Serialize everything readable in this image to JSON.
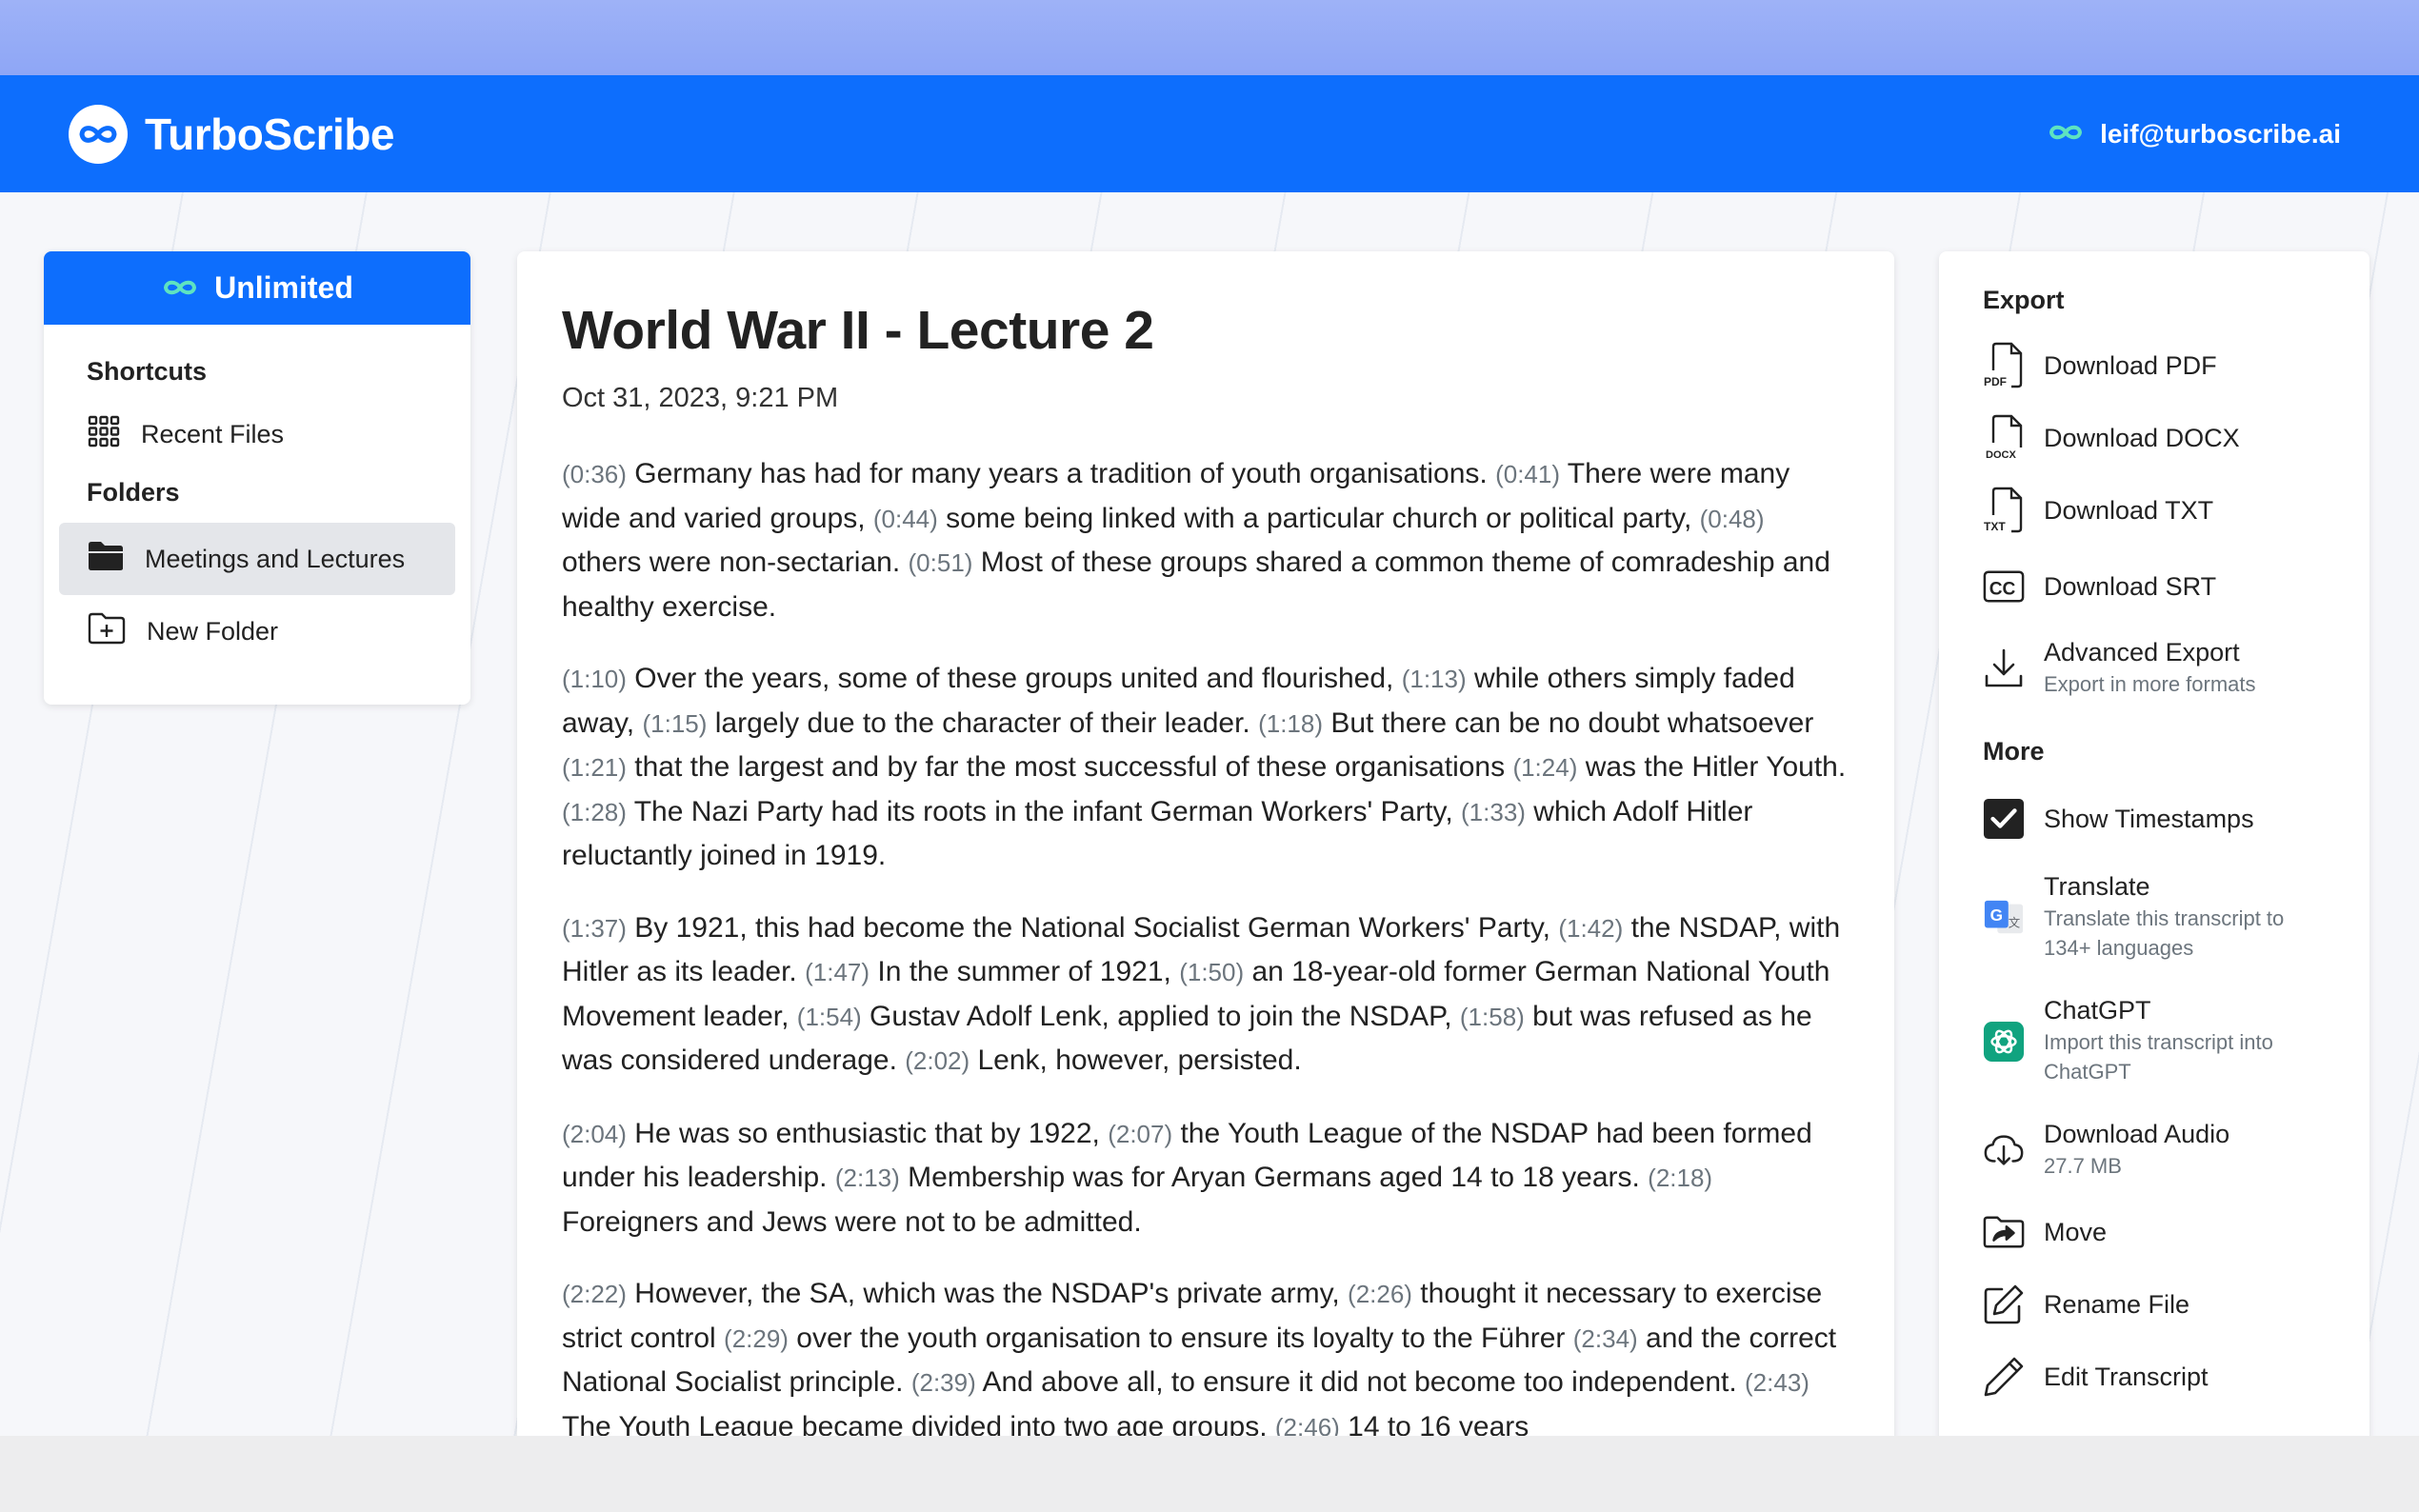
{
  "header": {
    "brand_name": "TurboScribe",
    "user_email": "leif@turboscribe.ai"
  },
  "sidebar": {
    "plan_label": "Unlimited",
    "shortcuts_heading": "Shortcuts",
    "recent_files_label": "Recent Files",
    "folders_heading": "Folders",
    "folders": [
      {
        "label": "Meetings and Lectures",
        "active": true
      },
      {
        "label": "New Folder",
        "active": false
      }
    ]
  },
  "document": {
    "title": "World War II - Lecture 2",
    "date": "Oct 31, 2023, 9:21 PM",
    "paragraphs": [
      [
        {
          "ts": "(0:36)",
          "text": " Germany has had for many years a tradition of youth organisations. "
        },
        {
          "ts": "(0:41)",
          "text": " There were many wide and varied groups, "
        },
        {
          "ts": "(0:44)",
          "text": " some being linked with a particular church or political party, "
        },
        {
          "ts": "(0:48)",
          "text": " others were non-sectarian. "
        },
        {
          "ts": "(0:51)",
          "text": " Most of these groups shared a common theme of comradeship and healthy exercise."
        }
      ],
      [
        {
          "ts": "(1:10)",
          "text": " Over the years, some of these groups united and flourished, "
        },
        {
          "ts": "(1:13)",
          "text": " while others simply faded away, "
        },
        {
          "ts": "(1:15)",
          "text": " largely due to the character of their leader. "
        },
        {
          "ts": "(1:18)",
          "text": " But there can be no doubt whatsoever "
        },
        {
          "ts": "(1:21)",
          "text": " that the largest and by far the most successful of these organisations "
        },
        {
          "ts": "(1:24)",
          "text": " was the Hitler Youth. "
        },
        {
          "ts": "(1:28)",
          "text": " The Nazi Party had its roots in the infant German Workers' Party, "
        },
        {
          "ts": "(1:33)",
          "text": " which Adolf Hitler reluctantly joined in 1919."
        }
      ],
      [
        {
          "ts": "(1:37)",
          "text": " By 1921, this had become the National Socialist German Workers' Party, "
        },
        {
          "ts": "(1:42)",
          "text": " the NSDAP, with Hitler as its leader. "
        },
        {
          "ts": "(1:47)",
          "text": " In the summer of 1921, "
        },
        {
          "ts": "(1:50)",
          "text": " an 18-year-old former German National Youth Movement leader, "
        },
        {
          "ts": "(1:54)",
          "text": " Gustav Adolf Lenk, applied to join the NSDAP, "
        },
        {
          "ts": "(1:58)",
          "text": " but was refused as he was considered underage. "
        },
        {
          "ts": "(2:02)",
          "text": " Lenk, however, persisted."
        }
      ],
      [
        {
          "ts": "(2:04)",
          "text": " He was so enthusiastic that by 1922, "
        },
        {
          "ts": "(2:07)",
          "text": " the Youth League of the NSDAP had been formed under his leadership. "
        },
        {
          "ts": "(2:13)",
          "text": " Membership was for Aryan Germans aged 14 to 18 years. "
        },
        {
          "ts": "(2:18)",
          "text": " Foreigners and Jews were not to be admitted."
        }
      ],
      [
        {
          "ts": "(2:22)",
          "text": " However, the SA, which was the NSDAP's private army, "
        },
        {
          "ts": "(2:26)",
          "text": " thought it necessary to exercise strict control "
        },
        {
          "ts": "(2:29)",
          "text": " over the youth organisation to ensure its loyalty to the Führer "
        },
        {
          "ts": "(2:34)",
          "text": " and the correct National Socialist principle. "
        },
        {
          "ts": "(2:39)",
          "text": " And above all, to ensure it did not become too independent. "
        },
        {
          "ts": "(2:43)",
          "text": " The Youth League became divided into two age groups. "
        },
        {
          "ts": "(2:46)",
          "text": " 14 to 16 years"
        }
      ]
    ]
  },
  "right_panel": {
    "export_heading": "Export",
    "download_pdf": "Download PDF",
    "download_docx": "Download DOCX",
    "download_txt": "Download TXT",
    "download_srt": "Download SRT",
    "advanced_export": "Advanced Export",
    "advanced_export_sub": "Export in more formats",
    "more_heading": "More",
    "show_timestamps": "Show Timestamps",
    "show_timestamps_checked": true,
    "translate": "Translate",
    "translate_sub_1": "Translate this transcript to",
    "translate_sub_2": "134+ languages",
    "chatgpt": "ChatGPT",
    "chatgpt_sub_1": "Import this transcript into",
    "chatgpt_sub_2": "ChatGPT",
    "download_audio": "Download Audio",
    "download_audio_size": "27.7 MB",
    "move": "Move",
    "rename_file": "Rename File",
    "edit_transcript": "Edit Transcript",
    "icon_labels": {
      "pdf": "PDF",
      "docx": "DOCX",
      "txt": "TXT",
      "srt": "CC"
    }
  },
  "colors": {
    "brand_blue": "#0d6efd",
    "infinity_green": "#5ee3c0",
    "chatgpt_green": "#10a37f",
    "translate_blue": "#4285f4"
  }
}
